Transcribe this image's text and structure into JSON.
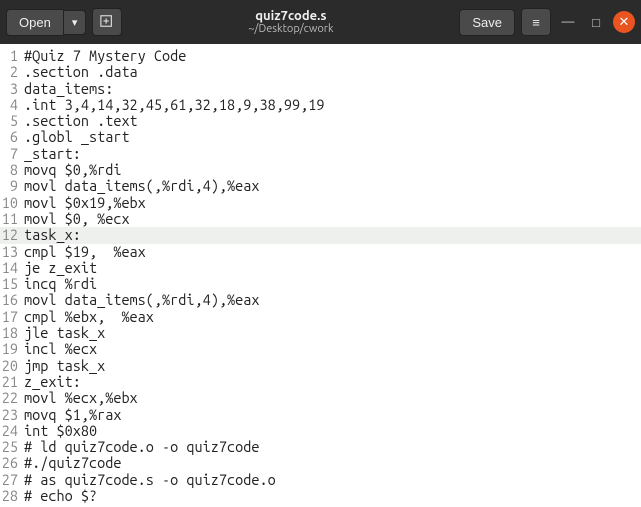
{
  "titlebar": {
    "open_label": "Open",
    "save_label": "Save",
    "filename": "quiz7code.s",
    "filepath": "~/Desktop/cwork",
    "dropdown_glyph": "▾",
    "newtab_glyph": "⊕",
    "hamburger_glyph": "≡",
    "minimize_glyph": "—",
    "maximize_glyph": "□",
    "close_glyph": "✕"
  },
  "lines": [
    {
      "n": "1",
      "text": "#Quiz 7 Mystery Code"
    },
    {
      "n": "2",
      "text": ".section .data"
    },
    {
      "n": "3",
      "text": "data_items:"
    },
    {
      "n": "4",
      "text": ".int 3,4,14,32,45,61,32,18,9,38,99,19"
    },
    {
      "n": "5",
      "text": ".section .text"
    },
    {
      "n": "6",
      "text": ".globl _start"
    },
    {
      "n": "7",
      "text": "_start:"
    },
    {
      "n": "8",
      "text": "movq $0,%rdi"
    },
    {
      "n": "9",
      "text": "movl data_items(,%rdi,4),%eax"
    },
    {
      "n": "10",
      "text": "movl $0x19,%ebx"
    },
    {
      "n": "11",
      "text": "movl $0, %ecx"
    },
    {
      "n": "12",
      "text": "task_x:",
      "hl": true
    },
    {
      "n": "13",
      "text": "cmpl $19,  %eax"
    },
    {
      "n": "14",
      "text": "je z_exit"
    },
    {
      "n": "15",
      "text": "incq %rdi"
    },
    {
      "n": "16",
      "text": "movl data_items(,%rdi,4),%eax"
    },
    {
      "n": "17",
      "text": "cmpl %ebx,  %eax"
    },
    {
      "n": "18",
      "text": "jle task_x"
    },
    {
      "n": "19",
      "text": "incl %ecx"
    },
    {
      "n": "20",
      "text": "jmp task_x"
    },
    {
      "n": "21",
      "text": "z_exit:"
    },
    {
      "n": "22",
      "text": "movl %ecx,%ebx"
    },
    {
      "n": "23",
      "text": "movq $1,%rax"
    },
    {
      "n": "24",
      "text": "int $0x80"
    },
    {
      "n": "25",
      "text": "# ld quiz7code.o -o quiz7code"
    },
    {
      "n": "26",
      "text": "#./quiz7code"
    },
    {
      "n": "27",
      "text": "# as quiz7code.s -o quiz7code.o"
    },
    {
      "n": "28",
      "text": "# echo $?"
    }
  ]
}
